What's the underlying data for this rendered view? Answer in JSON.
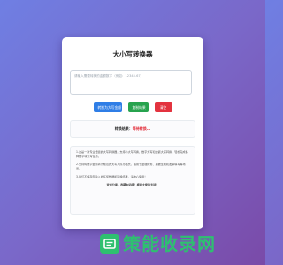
{
  "app": {
    "title": "大小写转换器"
  },
  "input": {
    "placeholder": "请输入需要转换的金额数字（例如：12345.67）"
  },
  "buttons": {
    "convert_label": "转换为大写金额",
    "copy_label": "复制结果",
    "clear_label": "清空"
  },
  "result": {
    "label": "转换结果：",
    "status": "等待转换..."
  },
  "help": {
    "paragraphs": [
      "1.这是一款专业便捷的大写转换器，支持小大写转换、数字大写和金额大写转换，轻松完成各种数字转大写任务。",
      "2.支持将数字金额转为规范的大写人民币格式，适用于金融财务、票据生成和发票填写等场景。",
      "3.我们不保存您输入的任何数据和转换结果，请放心使用！"
    ],
    "footer": "欢迎分享、收藏本站哦！感谢大家的支持！"
  },
  "watermark": {
    "text": "策能收录网"
  },
  "colors": {
    "convert": "#2f7ee6",
    "copy": "#27a34e",
    "clear": "#e3333f",
    "watermark": "#2ec070"
  }
}
